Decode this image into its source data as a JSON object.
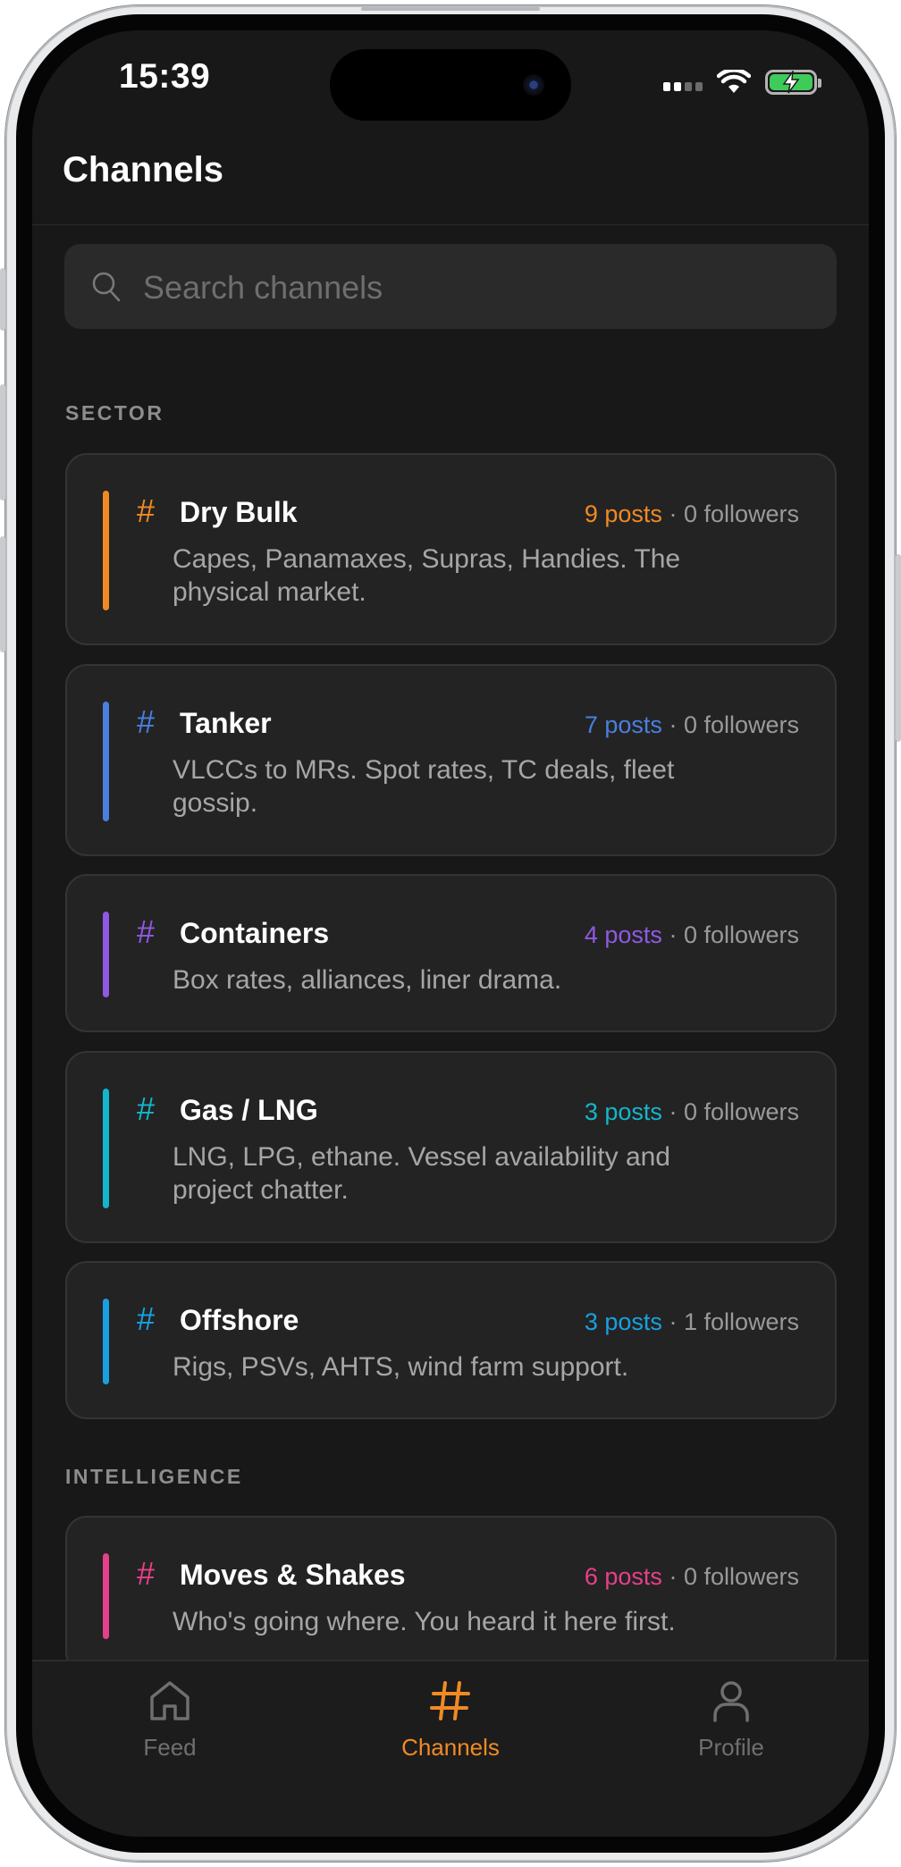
{
  "status_bar": {
    "time": "15:39"
  },
  "header": {
    "title": "Channels"
  },
  "search": {
    "placeholder": "Search channels"
  },
  "sections": [
    {
      "label": "SECTOR"
    },
    {
      "label": "INTELLIGENCE"
    }
  ],
  "channels": [
    {
      "hash": "#",
      "name": "Dry Bulk",
      "posts": "9 posts",
      "followers": "· 0 followers",
      "description": "Capes, Panamaxes, Supras, Handies. The physical market.",
      "color": "#f08a24"
    },
    {
      "hash": "#",
      "name": "Tanker",
      "posts": "7 posts",
      "followers": "· 0 followers",
      "description": "VLCCs to MRs. Spot rates, TC deals, fleet gossip.",
      "color": "#4a7fe0"
    },
    {
      "hash": "#",
      "name": "Containers",
      "posts": "4 posts",
      "followers": "· 0 followers",
      "description": "Box rates, alliances, liner drama.",
      "color": "#9059e3"
    },
    {
      "hash": "#",
      "name": "Gas / LNG",
      "posts": "3 posts",
      "followers": "· 0 followers",
      "description": "LNG, LPG, ethane. Vessel availability and project chatter.",
      "color": "#15b6cc"
    },
    {
      "hash": "#",
      "name": "Offshore",
      "posts": "3 posts",
      "followers": "· 1 followers",
      "description": "Rigs, PSVs, AHTS, wind farm support.",
      "color": "#1aa0e0"
    },
    {
      "hash": "#",
      "name": "Moves & Shakes",
      "posts": "6 posts",
      "followers": "· 0 followers",
      "description": "Who's going where. You heard it here first.",
      "color": "#e6408a"
    }
  ],
  "tabbar": {
    "active_color": "#f08a24",
    "inactive_color": "#6f6f6f",
    "tabs": [
      {
        "label": "Feed",
        "icon": "home-icon"
      },
      {
        "label": "Channels",
        "icon": "hash-icon"
      },
      {
        "label": "Profile",
        "icon": "person-icon"
      }
    ]
  }
}
